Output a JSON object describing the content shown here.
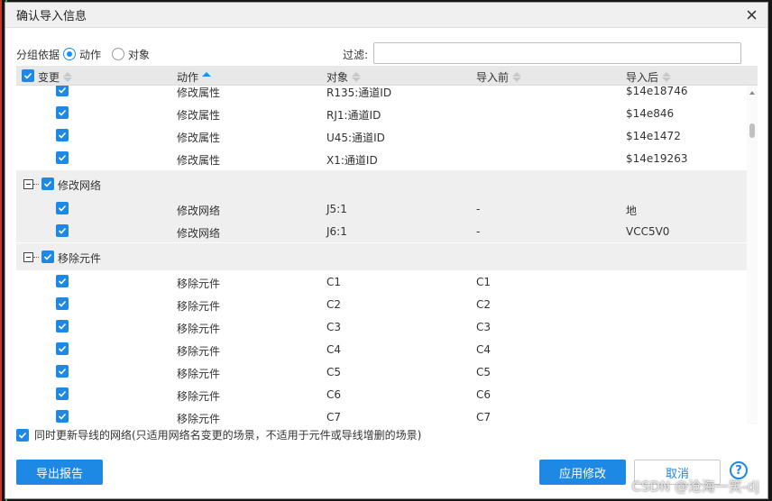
{
  "dialog": {
    "title": "确认导入信息"
  },
  "group_by": {
    "label": "分组依据",
    "options": [
      "动作",
      "对象"
    ],
    "selected": "动作"
  },
  "filter": {
    "label": "过滤:",
    "value": ""
  },
  "columns": [
    "变更",
    "动作",
    "对象",
    "导入前",
    "导入后"
  ],
  "rows_top": [
    {
      "action": "修改属性",
      "object": "R135:通道ID",
      "before": "",
      "after": "$14e18746"
    },
    {
      "action": "修改属性",
      "object": "RJ1:通道ID",
      "before": "",
      "after": "$14e846"
    },
    {
      "action": "修改属性",
      "object": "U45:通道ID",
      "before": "",
      "after": "$14e1472"
    },
    {
      "action": "修改属性",
      "object": "X1:通道ID",
      "before": "",
      "after": "$14e19263"
    }
  ],
  "group_net": {
    "label": "修改网络",
    "rows": [
      {
        "action": "修改网络",
        "object": "J5:1",
        "before": "-",
        "after": "地"
      },
      {
        "action": "修改网络",
        "object": "J6:1",
        "before": "-",
        "after": "VCC5V0"
      }
    ]
  },
  "group_remove": {
    "label": "移除元件",
    "rows": [
      {
        "action": "移除元件",
        "object": "C1",
        "before": "C1",
        "after": ""
      },
      {
        "action": "移除元件",
        "object": "C2",
        "before": "C2",
        "after": ""
      },
      {
        "action": "移除元件",
        "object": "C3",
        "before": "C3",
        "after": ""
      },
      {
        "action": "移除元件",
        "object": "C4",
        "before": "C4",
        "after": ""
      },
      {
        "action": "移除元件",
        "object": "C5",
        "before": "C5",
        "after": ""
      },
      {
        "action": "移除元件",
        "object": "C6",
        "before": "C6",
        "after": ""
      },
      {
        "action": "移除元件",
        "object": "C7",
        "before": "C7",
        "after": ""
      }
    ]
  },
  "sync_option": "同时更新导线的网络(只适用网络名变更的场景，不适用于元件或导线增删的场景)",
  "buttons": {
    "export": "导出报告",
    "apply": "应用修改",
    "cancel": "取消",
    "help": "?"
  },
  "watermark": "CSDN @沧海一笑-dj",
  "colors": {
    "accent": "#1e88e5"
  }
}
